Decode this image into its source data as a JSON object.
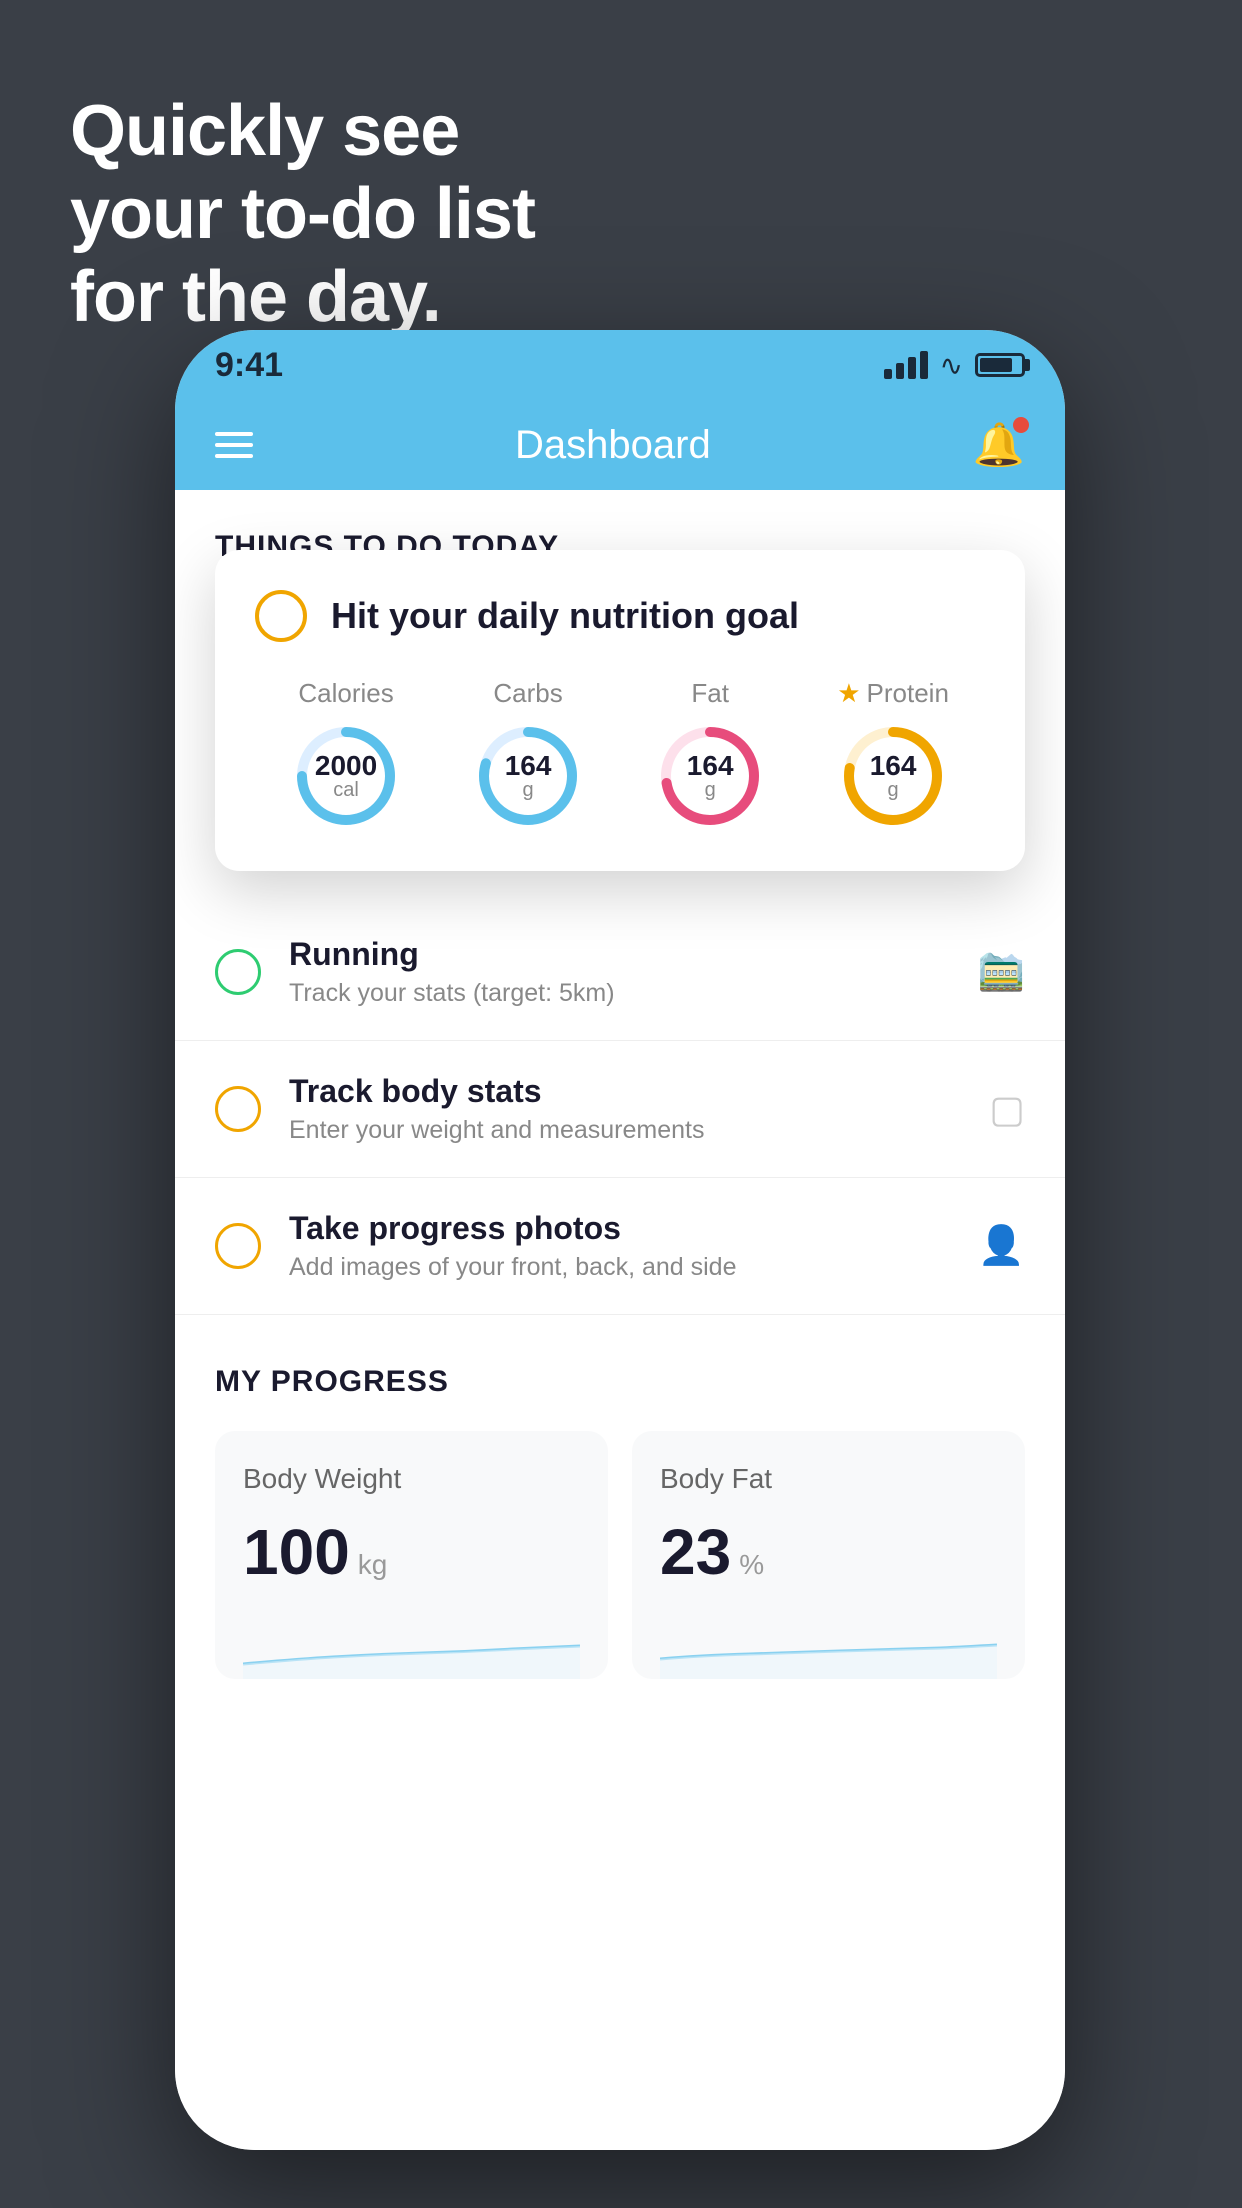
{
  "background_color": "#3a3f47",
  "headline": {
    "line1": "Quickly see",
    "line2": "your to-do list",
    "line3": "for the day."
  },
  "status_bar": {
    "time": "9:41"
  },
  "header": {
    "title": "Dashboard"
  },
  "things_section": {
    "label": "THINGS TO DO TODAY"
  },
  "floating_card": {
    "title": "Hit your daily nutrition goal",
    "items": [
      {
        "label": "Calories",
        "value": "2000",
        "unit": "cal",
        "color": "#5bc0eb",
        "track_color": "#ddeeff"
      },
      {
        "label": "Carbs",
        "value": "164",
        "unit": "g",
        "color": "#5bc0eb",
        "track_color": "#ddeeff"
      },
      {
        "label": "Fat",
        "value": "164",
        "unit": "g",
        "color": "#e74c7c",
        "track_color": "#fde0eb"
      },
      {
        "label": "Protein",
        "value": "164",
        "unit": "g",
        "color": "#f0a500",
        "track_color": "#fef0d0",
        "starred": true
      }
    ]
  },
  "todo_items": [
    {
      "title": "Running",
      "subtitle": "Track your stats (target: 5km)",
      "circle_color": "green",
      "icon": "👟"
    },
    {
      "title": "Track body stats",
      "subtitle": "Enter your weight and measurements",
      "circle_color": "yellow",
      "icon": "⚖"
    },
    {
      "title": "Take progress photos",
      "subtitle": "Add images of your front, back, and side",
      "circle_color": "yellow",
      "icon": "👤"
    }
  ],
  "progress_section": {
    "label": "MY PROGRESS",
    "cards": [
      {
        "title": "Body Weight",
        "value": "100",
        "unit": "kg"
      },
      {
        "title": "Body Fat",
        "value": "23",
        "unit": "%"
      }
    ]
  }
}
